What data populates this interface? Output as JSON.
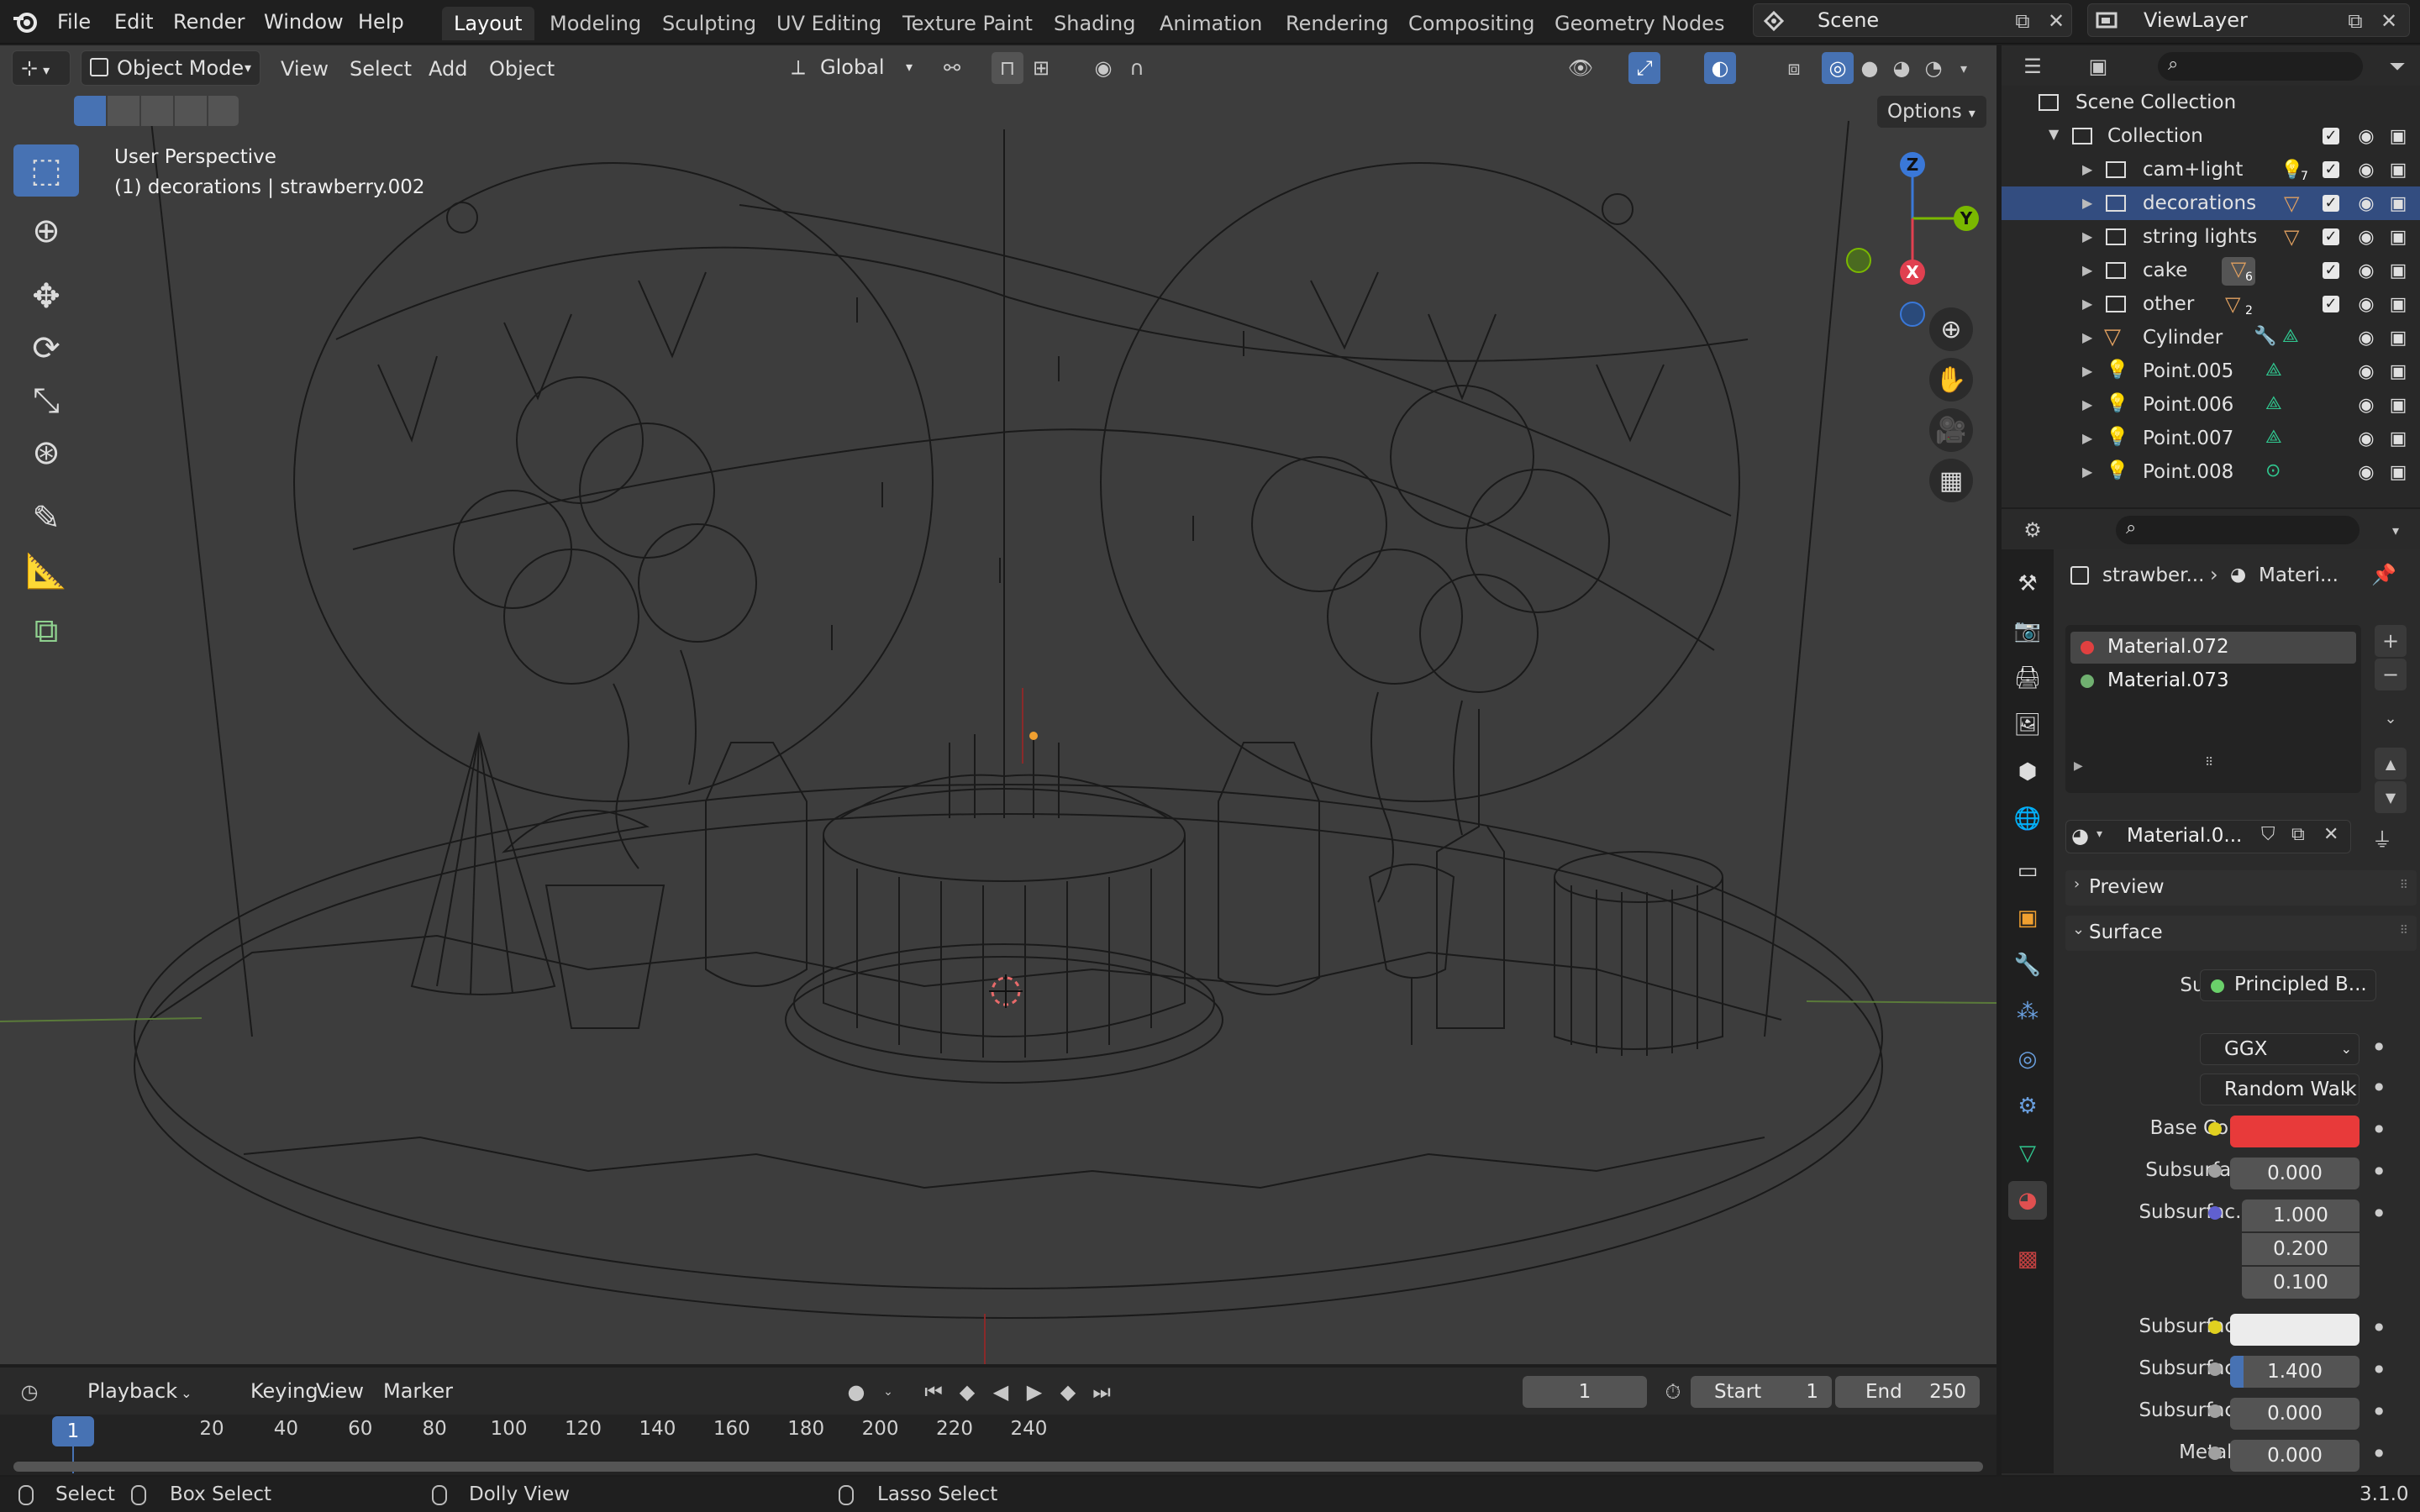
{
  "topbar": {
    "menus": [
      "File",
      "Edit",
      "Render",
      "Window",
      "Help"
    ],
    "workspaces": [
      "Layout",
      "Modeling",
      "Sculpting",
      "UV Editing",
      "Texture Paint",
      "Shading",
      "Animation",
      "Rendering",
      "Compositing",
      "Geometry Nodes"
    ],
    "active_workspace": "Layout",
    "scene_name": "Scene",
    "view_layer": "ViewLayer"
  },
  "viewport": {
    "mode": "Object Mode",
    "menus": [
      "View",
      "Select",
      "Add",
      "Object"
    ],
    "orientation": "Global",
    "options_label": "Options",
    "info_line1": "User Perspective",
    "info_line2": "(1) decorations | strawberry.002",
    "gizmo_labels": {
      "z": "Z",
      "y": "Y",
      "x": "X"
    }
  },
  "outliner": {
    "root": "Scene Collection",
    "collection": "Collection",
    "items": [
      {
        "label": "cam+light",
        "badge": "7"
      },
      {
        "label": "decorations",
        "badge": ""
      },
      {
        "label": "string lights",
        "badge": ""
      },
      {
        "label": "cake",
        "badge": "6"
      },
      {
        "label": "other",
        "badge": "2"
      },
      {
        "label": "Cylinder",
        "badge": ""
      },
      {
        "label": "Point.005",
        "badge": ""
      },
      {
        "label": "Point.006",
        "badge": ""
      },
      {
        "label": "Point.007",
        "badge": ""
      },
      {
        "label": "Point.008",
        "badge": ""
      }
    ]
  },
  "properties": {
    "breadcrumb_object": "strawber...",
    "breadcrumb_material": "Materi...",
    "slots": [
      "Material.072",
      "Material.073"
    ],
    "material_name": "Material.0...",
    "panel_preview": "Preview",
    "panel_surface": "Surface",
    "surface_label": "Surface",
    "surface_shader": "Principled B...",
    "distribution": "GGX",
    "subsurface_method": "Random Walk",
    "rows": {
      "base_color": "Base Color",
      "subsurface": "Subsurface",
      "subsurface_value": "0.000",
      "subsurface_radius": "Subsurfac...",
      "radius_values": [
        "1.000",
        "0.200",
        "0.100"
      ],
      "subsurface_color": "Subsurfac...",
      "subsurface_ior": "Subsurfac...",
      "subsurface_ior_value": "1.400",
      "subsurface_aniso": "Subsurfac...",
      "subsurface_aniso_value": "0.000",
      "metallic": "Metallic",
      "metallic_value": "0.000"
    },
    "base_color_hex": "#e83a3a"
  },
  "timeline": {
    "menus": [
      "Playback",
      "Keying",
      "View",
      "Marker"
    ],
    "current_frame": "1",
    "start_label": "Start",
    "start_value": "1",
    "end_label": "End",
    "end_value": "250",
    "ticks": [
      "1",
      "20",
      "40",
      "60",
      "80",
      "100",
      "120",
      "140",
      "160",
      "180",
      "200",
      "220",
      "240"
    ]
  },
  "statusbar": {
    "select": "Select",
    "box_select": "Box Select",
    "dolly_view": "Dolly View",
    "lasso_select": "Lasso Select",
    "version": "3.1.0"
  }
}
